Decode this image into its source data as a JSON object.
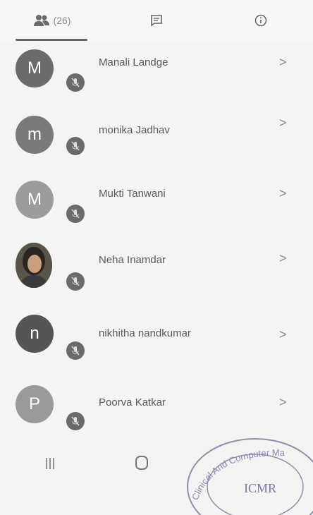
{
  "tabs": {
    "participants_count": "(26)",
    "items": [
      {
        "icon": "people-icon"
      },
      {
        "icon": "chat-icon"
      },
      {
        "icon": "info-icon"
      }
    ]
  },
  "participants": [
    {
      "initial": "M",
      "name": "Manali Landge",
      "avatar_color": "#6b6b6b"
    },
    {
      "initial": "m",
      "name": "monika Jadhav",
      "avatar_color": "#7a7a7a"
    },
    {
      "initial": "M",
      "name": "Mukti Tanwani",
      "avatar_color": "#9c9c9c"
    },
    {
      "initial": "",
      "name": "Neha Inamdar",
      "avatar_color": "#4a4438"
    },
    {
      "initial": "n",
      "name": "nikhitha nandkumar",
      "avatar_color": "#555555"
    },
    {
      "initial": "P",
      "name": "Poorva Katkar",
      "avatar_color": "#9a9a9a"
    }
  ],
  "chevron": ">",
  "stamp": {
    "text": "ICMR",
    "arc_text": "Clinical And Computer Ma"
  }
}
